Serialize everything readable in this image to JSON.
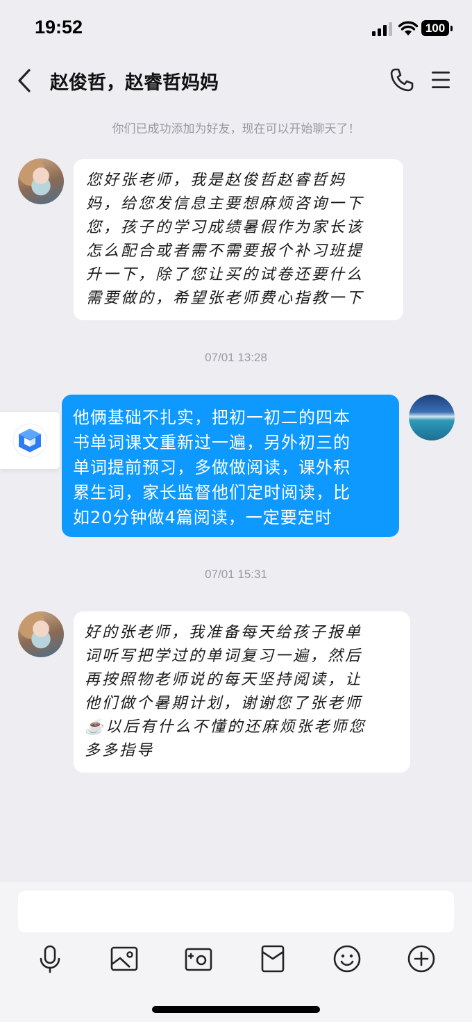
{
  "status_bar": {
    "time": "19:52",
    "battery": "100"
  },
  "header": {
    "title": "赵俊哲，赵睿哲妈妈"
  },
  "chat": {
    "notice": "你们已成功添加为好友，现在可以开始聊天了！",
    "messages": [
      {
        "direction": "incoming",
        "text": "您好张老师，我是赵俊哲赵睿哲妈\n妈，给您发信息主要想麻烦咨询一下\n您，孩子的学习成绩暑假作为家长该\n怎么配合或者需不需要报个补习班提\n升一下，除了您让买的试卷还要什么\n需要做的，希望张老师费心指教一下"
      },
      {
        "timestamp": "07/01 13:28"
      },
      {
        "direction": "outgoing",
        "text": "他俩基础不扎实，把初一初二的四本\n书单词课文重新过一遍，另外初三的\n单词提前预习，多做做阅读，课外积\n累生词，家长监督他们定时阅读，比\n如20分钟做4篇阅读，一定要定时"
      },
      {
        "timestamp": "07/01 15:31"
      },
      {
        "direction": "incoming",
        "text": "好的张老师，我准备每天给孩子报单\n词听写把学过的单词复习一遍，然后\n再按照物老师说的每天坚持阅读，让\n他们做个暑期计划，谢谢您了张老师\n☕以后有什么不懂的还麻烦张老师您\n多多指导"
      }
    ]
  },
  "composer": {
    "input_value": "",
    "tools": [
      "microphone-icon",
      "image-icon",
      "camera-icon",
      "red-packet-icon",
      "emoji-icon",
      "plus-icon"
    ]
  },
  "colors": {
    "background": "#ededf2",
    "outgoing_bubble": "#0d99ff",
    "incoming_bubble": "#ffffff"
  }
}
